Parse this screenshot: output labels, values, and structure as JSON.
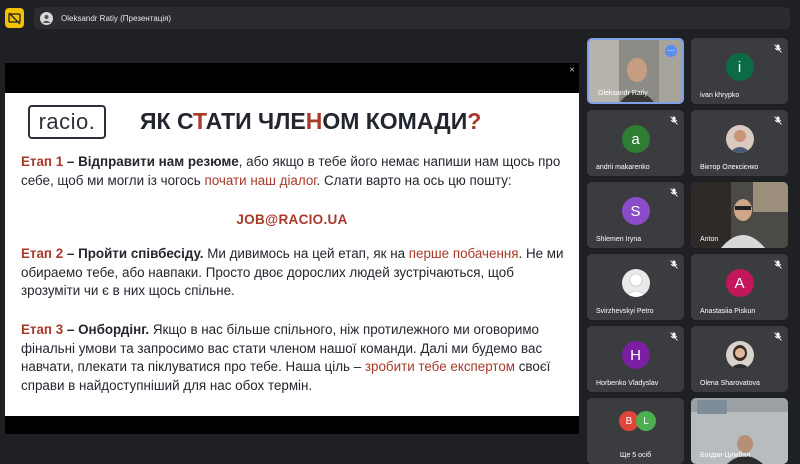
{
  "window": {
    "title": "Oleksandr Ratiy (Презентація)"
  },
  "slide": {
    "logo": "racio.",
    "title_parts": [
      "ЯК С",
      "Т",
      "АТИ ЧЛЕ",
      "Н",
      "ОМ КОМАДИ",
      "?"
    ],
    "stage1": {
      "label": "Етап 1",
      "bold": " – Відправити нам резюме",
      "text1": ", або якщо в тебе його немає напиши нам щось про себе, щоб ми могли із чогось ",
      "highlight": "почати наш діалог",
      "text2": ". Слати варто на ось цю пошту:"
    },
    "email": "JOB@RACIO.UA",
    "stage2": {
      "label": "Етап 2",
      "bold": " – Пройти співбесіду.",
      "text1": " Ми дивимось на цей етап, як на ",
      "highlight": "перше побачення",
      "text2": ". Не ми обираемо тебе, або навпаки. Просто двоє дорослих людей зустрічаються, щоб зрозуміти чи є в них щось спільне."
    },
    "stage3": {
      "label": "Етап 3",
      "bold": " – Онбордінг.",
      "text1": " Якщо в нас більше спільного, ніж протилежного ми оговоримо фінальні умови та запросимо вас стати членом нашої команди. Далі ми будемо вас навчати, плекати та піклуватися про тебе. Наша ціль – ",
      "highlight": "зробити тебе експертом",
      "text2": " своєї справи в найдоступніший для нас обох термін."
    }
  },
  "participants": [
    {
      "name": "Oleksandr Ratiy",
      "initial": "",
      "color": ""
    },
    {
      "name": "ivan khrypko",
      "initial": "i",
      "color": "#0b6b45"
    },
    {
      "name": "andrii makarenko",
      "initial": "a",
      "color": "#2e7d32"
    },
    {
      "name": "Віктор Олексієнко",
      "initial": "",
      "color": ""
    },
    {
      "name": "Shlemen Iryna",
      "initial": "S",
      "color": "#8a4cc9"
    },
    {
      "name": "Anton",
      "initial": "",
      "color": ""
    },
    {
      "name": "Svirzhevskyi Petro",
      "initial": "",
      "color": ""
    },
    {
      "name": "Anastasiia Piskun",
      "initial": "A",
      "color": "#c2185b"
    },
    {
      "name": "Horbenko Vladyslav",
      "initial": "H",
      "color": "#7b1fa2"
    },
    {
      "name": "Olena Sharovatova",
      "initial": "",
      "color": ""
    },
    {
      "name": "Ще 5 осіб",
      "initial": "",
      "color": ""
    },
    {
      "name": "Богдан Цимбал",
      "initial": "",
      "color": ""
    }
  ],
  "more_tile": {
    "label": "Ще 5 осіб",
    "avatars": [
      {
        "initial": "B",
        "color": "#e0443a"
      },
      {
        "initial": "L",
        "color": "#4caf50"
      }
    ]
  },
  "colors": {
    "accent": "#a8392b",
    "background": "#1f2023",
    "tile": "#3b3c3f",
    "share_button": "#f2c200"
  }
}
